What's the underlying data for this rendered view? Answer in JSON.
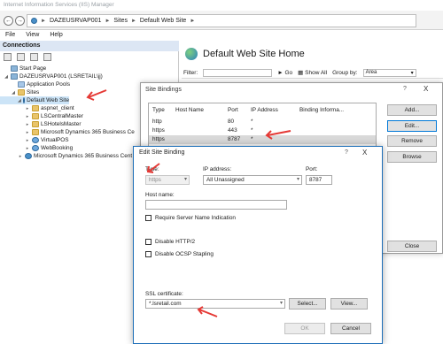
{
  "window": {
    "title": "Internet Information Services (IIS) Manager"
  },
  "address": {
    "segments": [
      "DAZEUSRVAP001",
      "Sites",
      "Default Web Site"
    ]
  },
  "menu": [
    "File",
    "View",
    "Help"
  ],
  "connections": {
    "header": "Connections",
    "tree": [
      {
        "label": "Start Page"
      },
      {
        "label": "DAZEUSRVAP001 (LSRETAIL\\jj)"
      },
      {
        "label": "Application Pools"
      },
      {
        "label": "Sites"
      },
      {
        "label": "Default Web Site"
      },
      {
        "label": "aspnet_client"
      },
      {
        "label": "LSCentralMaster"
      },
      {
        "label": "LSHotelsMaster"
      },
      {
        "label": "Microsoft Dynamics 365 Business Ce"
      },
      {
        "label": "VirtualPOS"
      },
      {
        "label": "WebBooking"
      },
      {
        "label": "Microsoft Dynamics 365 Business Cent"
      }
    ]
  },
  "home": {
    "title": "Default Web Site Home",
    "filter_label": "Filter:",
    "go_label": "Go",
    "show_all_label": "Show All",
    "group_by_label": "Group by:",
    "group_by_value": "Area"
  },
  "site_bindings": {
    "title": "Site Bindings",
    "help": "?",
    "close": "X",
    "columns": [
      "Type",
      "Host Name",
      "Port",
      "IP Address",
      "Binding Informa..."
    ],
    "rows": [
      {
        "type": "http",
        "host": "",
        "port": "80",
        "ip": "*",
        "info": ""
      },
      {
        "type": "https",
        "host": "",
        "port": "443",
        "ip": "*",
        "info": ""
      },
      {
        "type": "https",
        "host": "",
        "port": "8787",
        "ip": "*",
        "info": ""
      }
    ],
    "buttons": {
      "add": "Add...",
      "edit": "Edit...",
      "remove": "Remove",
      "browse": "Browse",
      "close": "Close"
    }
  },
  "edit_binding": {
    "title": "Edit Site Binding",
    "help": "?",
    "close": "X",
    "type_label": "Type:",
    "type_value": "https",
    "ip_label": "IP address:",
    "ip_value": "All Unassigned",
    "port_label": "Port:",
    "port_value": "8787",
    "host_label": "Host name:",
    "host_value": "",
    "sni_label": "Require Server Name Indication",
    "http2_label": "Disable HTTP/2",
    "ocsp_label": "Disable OCSP Stapling",
    "cert_label": "SSL certificate:",
    "cert_value": "*.lsretail.com",
    "select_button": "Select...",
    "view_button": "View...",
    "ok_button": "OK",
    "cancel_button": "Cancel"
  },
  "colors": {
    "accent": "#0078d7",
    "annotation_arrow": "#e53935",
    "selection": "#cce4f7"
  }
}
